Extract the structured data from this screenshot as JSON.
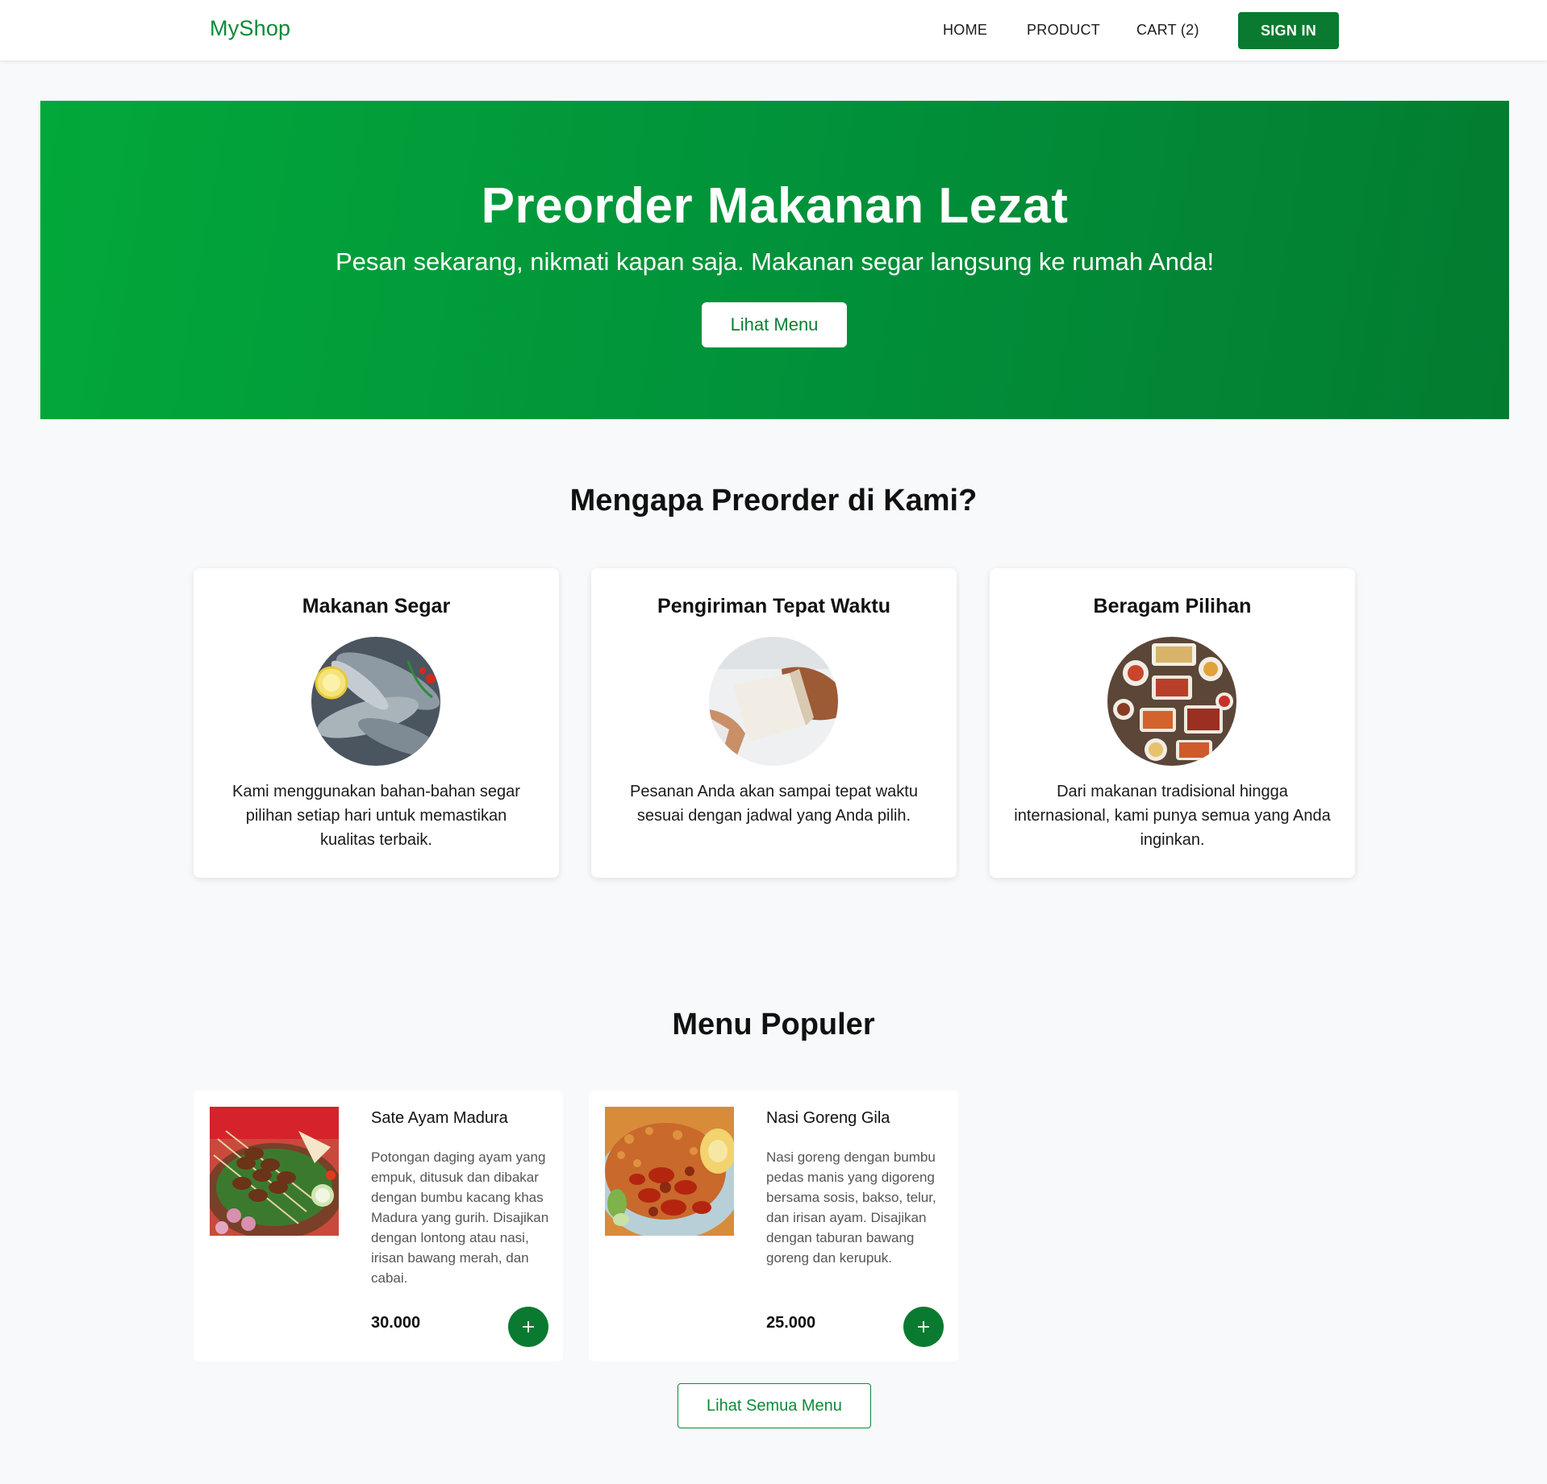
{
  "navbar": {
    "brand": "MyShop",
    "links": [
      {
        "label": "HOME"
      },
      {
        "label": "PRODUCT"
      },
      {
        "label": "CART (2)"
      }
    ],
    "signin_label": "SIGN IN"
  },
  "hero": {
    "title": "Preorder Makanan Lezat",
    "subtitle": "Pesan sekarang, nikmati kapan saja. Makanan segar langsung ke rumah Anda!",
    "button_label": "Lihat Menu"
  },
  "why": {
    "title": "Mengapa Preorder di Kami?",
    "features": [
      {
        "title": "Makanan Segar",
        "text": "Kami menggunakan bahan-bahan segar pilihan setiap hari untuk memastikan kualitas terbaik."
      },
      {
        "title": "Pengiriman Tepat Waktu",
        "text": "Pesanan Anda akan sampai tepat waktu sesuai dengan jadwal yang Anda pilih."
      },
      {
        "title": "Beragam Pilihan",
        "text": "Dari makanan tradisional hingga internasional, kami punya semua yang Anda inginkan."
      }
    ]
  },
  "menu": {
    "title": "Menu Populer",
    "items": [
      {
        "name": "Sate Ayam Madura",
        "description": "Potongan daging ayam yang empuk, ditusuk dan dibakar dengan bumbu kacang khas Madura yang gurih. Disajikan dengan lontong atau nasi, irisan bawang merah, dan cabai.",
        "price": "30.000"
      },
      {
        "name": "Nasi Goreng Gila",
        "description": "Nasi goreng dengan bumbu pedas manis yang digoreng bersama sosis, bakso, telur, dan irisan ayam. Disajikan dengan taburan bawang goreng dan kerupuk.",
        "price": "25.000"
      }
    ],
    "all_menu_label": "Lihat Semua Menu"
  },
  "colors": {
    "brand": "#0c8a37",
    "primary_button": "#0a7a30",
    "hero_gradient_start": "#02a83a",
    "hero_gradient_end": "#037c30",
    "page_background": "#f8f9fb"
  }
}
